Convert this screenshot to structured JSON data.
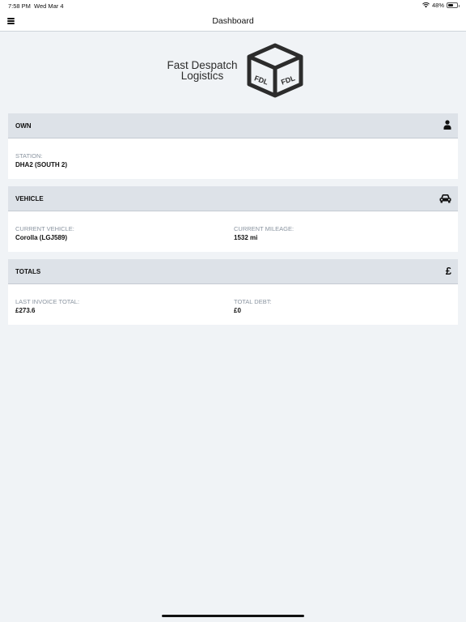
{
  "status_bar": {
    "time": "7:58 PM",
    "date": "Wed Mar 4",
    "battery_percent": "48%",
    "wifi_icon": "wifi-icon",
    "battery_icon": "battery-icon"
  },
  "nav": {
    "title": "Dashboard",
    "menu_icon": "hamburger-menu-icon"
  },
  "logo": {
    "line1": "Fast Despatch",
    "line2": "Logistics",
    "box_text": "FDL"
  },
  "own": {
    "title": "OWN",
    "icon": "user-icon",
    "station_label": "STATION:",
    "station_value": "DHA2 (SOUTH 2)"
  },
  "vehicle": {
    "title": "VEHICLE",
    "icon": "car-icon",
    "current_vehicle_label": "CURRENT VEHICLE:",
    "current_vehicle_value": "Corolla (LGJ589)",
    "current_mileage_label": "CURRENT MILEAGE:",
    "current_mileage_value": "1532 mi"
  },
  "totals": {
    "title": "TOTALS",
    "icon": "pound-icon",
    "icon_glyph": "£",
    "last_invoice_label": "LAST INVOICE TOTAL:",
    "last_invoice_value": "£273.6",
    "total_debt_label": "TOTAL DEBT:",
    "total_debt_value": "£0"
  },
  "colors": {
    "background": "#f0f3f6",
    "card_header": "#dde2e8",
    "label": "#8a94a0",
    "text": "#111111"
  }
}
